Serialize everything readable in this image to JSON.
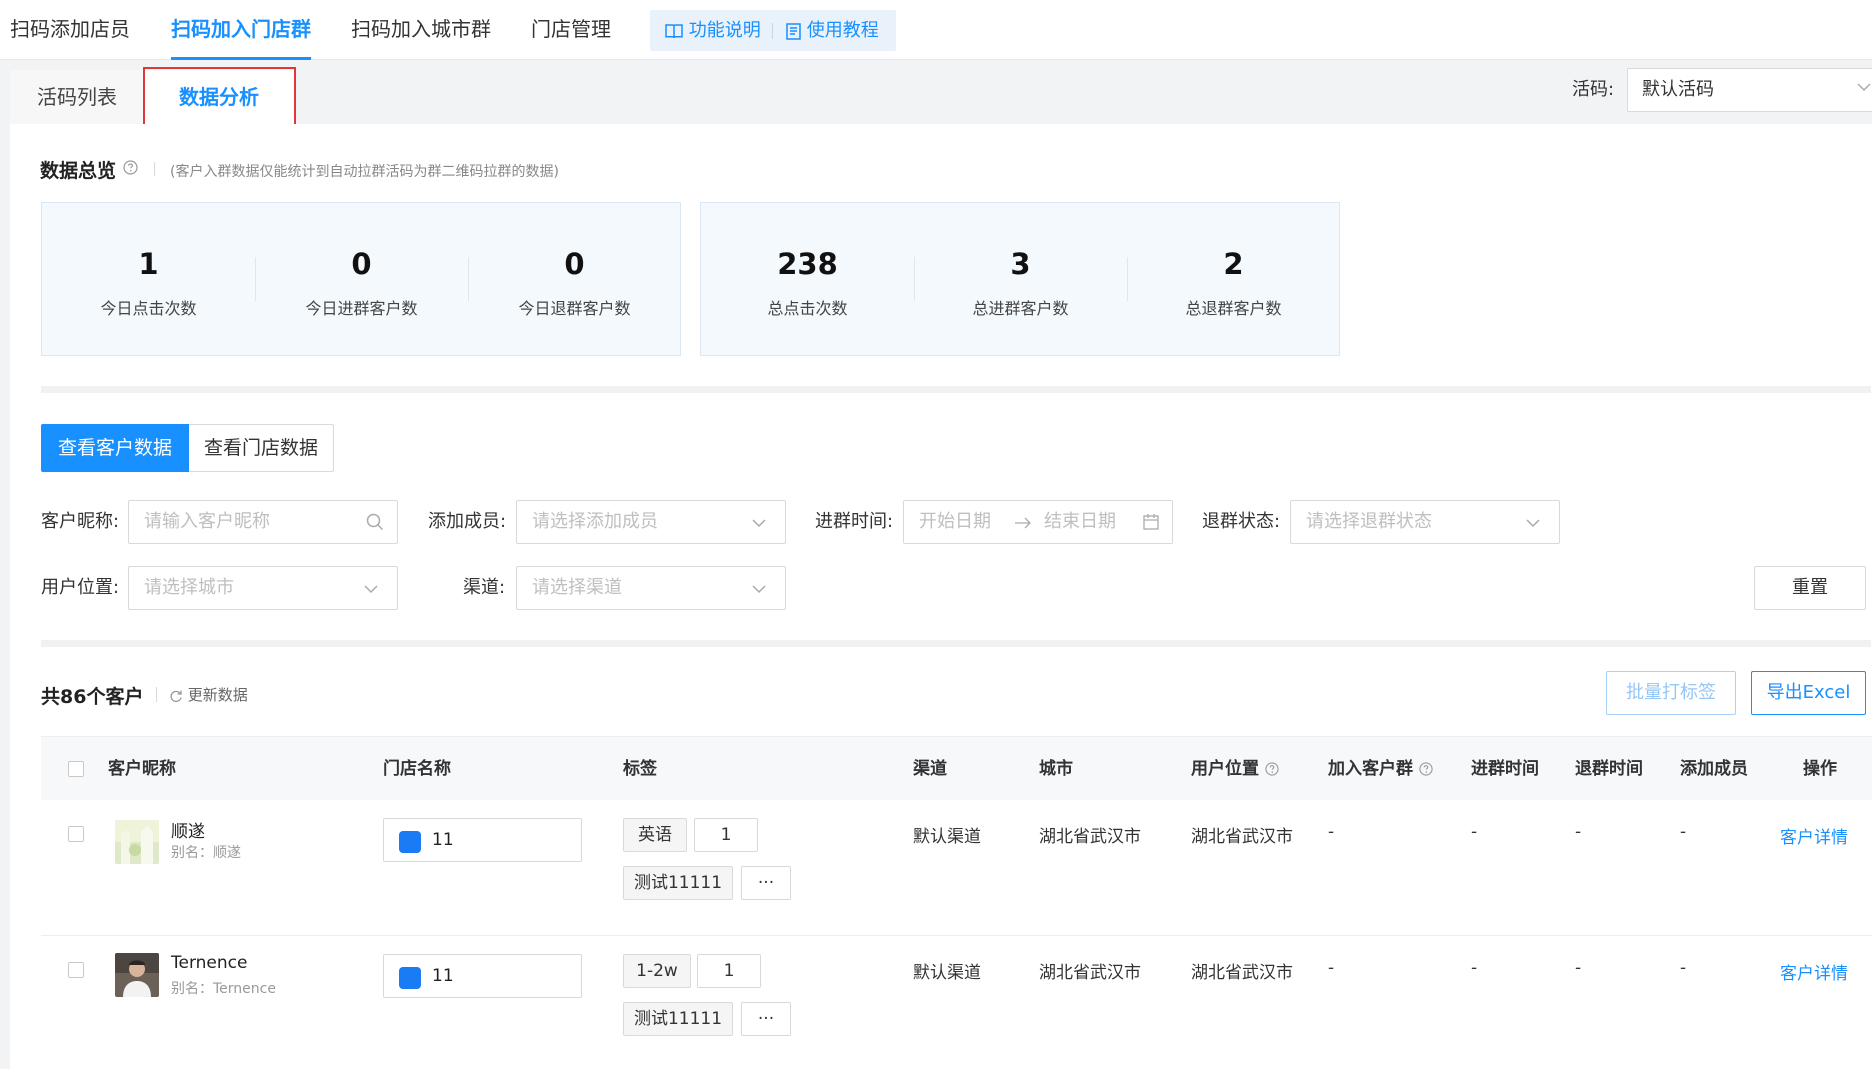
{
  "topnav": {
    "tabs": [
      "扫码添加店员",
      "扫码加入门店群",
      "扫码加入城市群",
      "门店管理"
    ],
    "help": "功能说明",
    "tutorial": "使用教程"
  },
  "subtabs": [
    "活码列表",
    "数据分析"
  ],
  "code_select": {
    "label": "活码:",
    "value": "默认活码"
  },
  "overview": {
    "title": "数据总览",
    "note": "(客户入群数据仅能统计到自动拉群活码为群二维码拉群的数据)",
    "today": [
      {
        "value": "1",
        "label": "今日点击次数"
      },
      {
        "value": "0",
        "label": "今日进群客户数"
      },
      {
        "value": "0",
        "label": "今日退群客户数"
      }
    ],
    "total": [
      {
        "value": "238",
        "label": "总点击次数"
      },
      {
        "value": "3",
        "label": "总进群客户数"
      },
      {
        "value": "2",
        "label": "总退群客户数"
      }
    ]
  },
  "view_toggle": {
    "customer": "查看客户数据",
    "store": "查看门店数据"
  },
  "filters": {
    "nickname": {
      "label": "客户昵称:",
      "placeholder": "请输入客户昵称"
    },
    "member": {
      "label": "添加成员:",
      "placeholder": "请选择添加成员"
    },
    "join_time": {
      "label": "进群时间:",
      "start": "开始日期",
      "end": "结束日期"
    },
    "quit_status": {
      "label": "退群状态:",
      "placeholder": "请选择退群状态"
    },
    "location": {
      "label": "用户位置:",
      "placeholder": "请选择城市"
    },
    "channel": {
      "label": "渠道:",
      "placeholder": "请选择渠道"
    },
    "reset": "重置"
  },
  "list": {
    "count": "共86个客户",
    "refresh": "更新数据",
    "batch_tag": "批量打标签",
    "export": "导出Excel",
    "columns": [
      "客户昵称",
      "门店名称",
      "标签",
      "渠道",
      "城市",
      "用户位置",
      "加入客户群",
      "进群时间",
      "退群时间",
      "添加成员",
      "操作"
    ],
    "rows": [
      {
        "nickname": "顺遂",
        "alias": "别名：顺遂",
        "store": "11",
        "tags": [
          "英语",
          "1",
          "测试11111",
          "···"
        ],
        "channel": "默认渠道",
        "city": "湖北省武汉市",
        "location": "湖北省武汉市",
        "group": "-",
        "join_time": "-",
        "quit_time": "-",
        "member": "-",
        "action": "客户详情"
      },
      {
        "nickname": "Ternence",
        "alias": "别名：Ternence",
        "store": "11",
        "tags": [
          "1-2w",
          "1",
          "测试11111",
          "···"
        ],
        "channel": "默认渠道",
        "city": "湖北省武汉市",
        "location": "湖北省武汉市",
        "group": "-",
        "join_time": "-",
        "quit_time": "-",
        "member": "-",
        "action": "客户详情"
      }
    ]
  },
  "colors": {
    "primary": "#1890ff",
    "highlight_border": "#e0373a"
  }
}
